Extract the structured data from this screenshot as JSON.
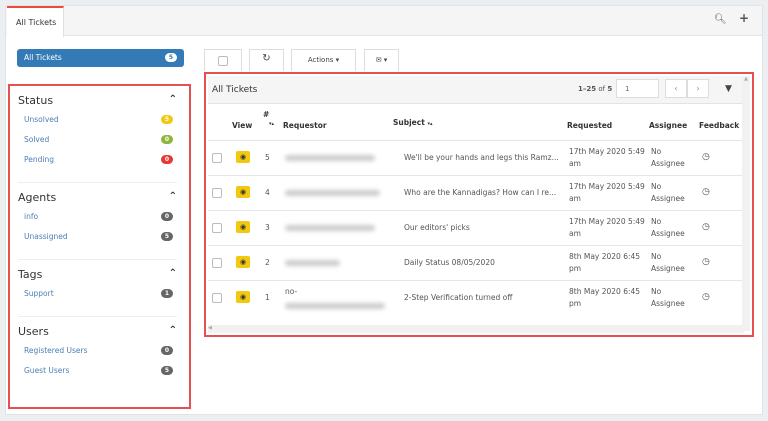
{
  "tabs": [
    {
      "label": "All Tickets"
    }
  ],
  "all_tickets_button": {
    "label": "All Tickets",
    "count": "5"
  },
  "sidebar": {
    "sections": [
      {
        "title": "Status",
        "items": [
          {
            "label": "Unsolved",
            "count": "5",
            "color": "#f2c811"
          },
          {
            "label": "Solved",
            "count": "0",
            "color": "#8cb63c"
          },
          {
            "label": "Pending",
            "count": "0",
            "color": "#e53935"
          }
        ]
      },
      {
        "title": "Agents",
        "items": [
          {
            "label": "info",
            "count": "0",
            "color": "#666666"
          },
          {
            "label": "Unassigned",
            "count": "5",
            "color": "#666666"
          }
        ]
      },
      {
        "title": "Tags",
        "items": [
          {
            "label": "Support",
            "count": "1",
            "color": "#666666"
          }
        ]
      },
      {
        "title": "Users",
        "items": [
          {
            "label": "Registered Users",
            "count": "0",
            "color": "#666666"
          },
          {
            "label": "Guest Users",
            "count": "5",
            "color": "#666666"
          }
        ]
      }
    ]
  },
  "toolbar": {
    "actions_label": "Actions"
  },
  "panel": {
    "title": "All Tickets",
    "range": "1–25",
    "of": "of",
    "total": "5",
    "page": "1"
  },
  "columns": {
    "view": "View",
    "num": "#",
    "requestor": "Requestor",
    "subject": "Subject",
    "requested": "Requested",
    "assignee": "Assignee",
    "feedback": "Feedback"
  },
  "rows": [
    {
      "num": "5",
      "requestor_prefix": "",
      "subject": "We'll be your hands and legs this Ramz...",
      "requested": "17th May 2020 5:49 am",
      "assignee": "No Assignee"
    },
    {
      "num": "4",
      "requestor_prefix": "",
      "subject": "Who are the Kannadigas? How can I re...",
      "requested": "17th May 2020 5:49 am",
      "assignee": "No Assignee"
    },
    {
      "num": "3",
      "requestor_prefix": "",
      "subject": "Our editors' picks",
      "requested": "17th May 2020 5:49 am",
      "assignee": "No Assignee"
    },
    {
      "num": "2",
      "requestor_prefix": "",
      "subject": "Daily Status 08/05/2020",
      "requested": "8th May 2020 6:45 pm",
      "assignee": "No Assignee"
    },
    {
      "num": "1",
      "requestor_prefix": "no-",
      "subject": "2-Step Verification turned off",
      "requested": "8th May 2020 6:45 pm",
      "assignee": "No Assignee"
    }
  ]
}
